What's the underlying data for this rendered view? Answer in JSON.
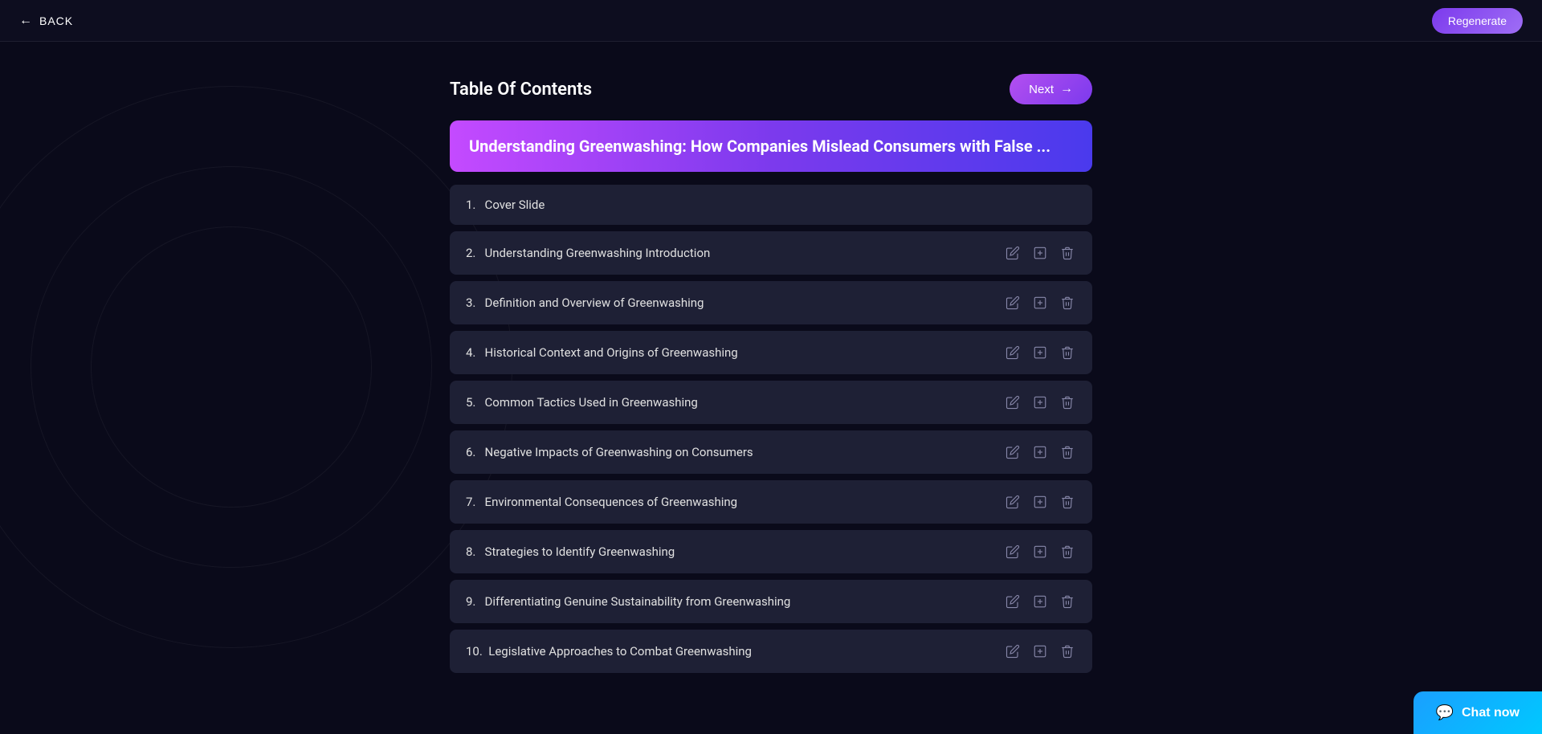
{
  "navbar": {
    "back_label": "BACK",
    "regenerate_label": "Regenerate"
  },
  "header": {
    "title": "Table Of Contents",
    "next_label": "Next"
  },
  "title_banner": {
    "text": "Understanding Greenwashing: How Companies Mislead Consumers with False ..."
  },
  "toc_items": [
    {
      "number": "1.",
      "label": "Cover Slide",
      "has_actions": false
    },
    {
      "number": "2.",
      "label": "Understanding Greenwashing Introduction",
      "has_actions": true
    },
    {
      "number": "3.",
      "label": "Definition and Overview of Greenwashing",
      "has_actions": true
    },
    {
      "number": "4.",
      "label": "Historical Context and Origins of Greenwashing",
      "has_actions": true
    },
    {
      "number": "5.",
      "label": "Common Tactics Used in Greenwashing",
      "has_actions": true
    },
    {
      "number": "6.",
      "label": "Negative Impacts of Greenwashing on Consumers",
      "has_actions": true
    },
    {
      "number": "7.",
      "label": "Environmental Consequences of Greenwashing",
      "has_actions": true
    },
    {
      "number": "8.",
      "label": "Strategies to Identify Greenwashing",
      "has_actions": true
    },
    {
      "number": "9.",
      "label": "Differentiating Genuine Sustainability from Greenwashing",
      "has_actions": true
    },
    {
      "number": "10.",
      "label": "Legislative Approaches to Combat Greenwashing",
      "has_actions": true
    }
  ],
  "chat_now": {
    "label": "Chat now"
  }
}
